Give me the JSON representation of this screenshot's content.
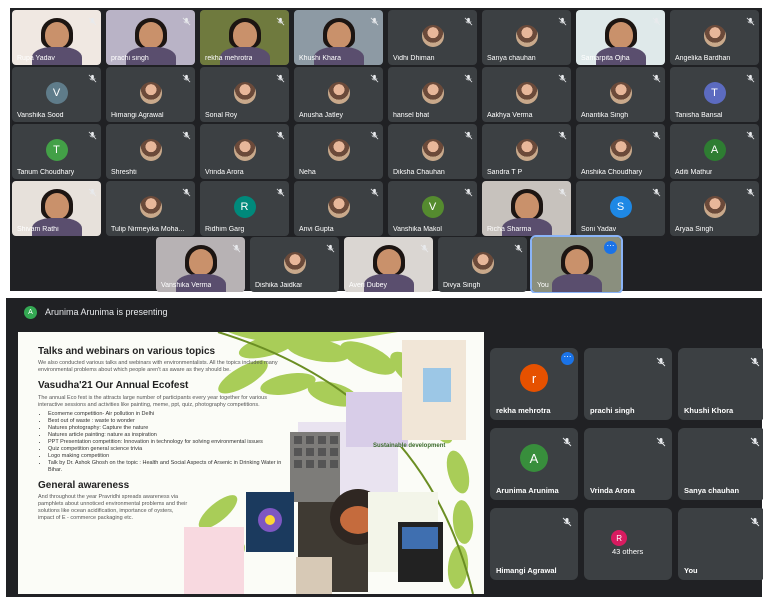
{
  "grid": {
    "row1": [
      {
        "name": "Rupa Yadav",
        "type": "camera",
        "bg": "#f0e8e2"
      },
      {
        "name": "prachi singh",
        "type": "camera",
        "bg": "#b9b3c6"
      },
      {
        "name": "rekha mehrotra",
        "type": "camera",
        "bg": "#6f7a3e"
      },
      {
        "name": "Khushi Khara",
        "type": "camera",
        "bg": "#8d9aa4"
      },
      {
        "name": "Vidhi Dhiman",
        "type": "photo"
      },
      {
        "name": "Sanya chauhan",
        "type": "photo"
      },
      {
        "name": "Samarpita Ojha",
        "type": "camera",
        "bg": "#dfe9ea"
      },
      {
        "name": "Angelika Bardhan",
        "type": "photo"
      }
    ],
    "row2": [
      {
        "name": "Vanshika Sood",
        "type": "letter",
        "letter": "V",
        "color": "#5f7c8a"
      },
      {
        "name": "Himangi Agrawal",
        "type": "photo"
      },
      {
        "name": "Sonal Roy",
        "type": "photo"
      },
      {
        "name": "Anusha Jatley",
        "type": "photo"
      },
      {
        "name": "hansel bhat",
        "type": "photo"
      },
      {
        "name": "Aakhya Verma",
        "type": "photo"
      },
      {
        "name": "Anantika Singh",
        "type": "photo"
      },
      {
        "name": "Tanisha Bansal",
        "type": "letter",
        "letter": "T",
        "color": "#5c6bc0"
      }
    ],
    "row3": [
      {
        "name": "Tanum Choudhary",
        "type": "letter",
        "letter": "T",
        "color": "#43a047"
      },
      {
        "name": "Shreshti",
        "type": "photo"
      },
      {
        "name": "Vrinda Arora",
        "type": "photo"
      },
      {
        "name": "Neha",
        "type": "photo"
      },
      {
        "name": "Diksha Chauhan",
        "type": "photo"
      },
      {
        "name": "Sandra T P",
        "type": "photo"
      },
      {
        "name": "Anshika Choudhary",
        "type": "photo"
      },
      {
        "name": "Aditi Mathur",
        "type": "letter",
        "letter": "A",
        "color": "#2e7d32"
      }
    ],
    "row4": [
      {
        "name": "Shivam Rathi",
        "type": "camera",
        "bg": "#e7e1db"
      },
      {
        "name": "Tulip Nirmeyika Moha...",
        "type": "photo"
      },
      {
        "name": "Ridhim Garg",
        "type": "letter",
        "letter": "R",
        "color": "#00897b"
      },
      {
        "name": "Anvi Gupta",
        "type": "photo"
      },
      {
        "name": "Vanshika Makol",
        "type": "letter",
        "letter": "V",
        "color": "#558b2f"
      },
      {
        "name": "Richa Sharma",
        "type": "camera",
        "bg": "#c7c2bd"
      },
      {
        "name": "Soni Yadav",
        "type": "letter",
        "letter": "S",
        "color": "#1e88e5"
      },
      {
        "name": "Aryaa Singh",
        "type": "photo"
      }
    ],
    "row5": [
      {
        "name": "Vanshika Verma",
        "type": "camera",
        "bg": "#b7b2b4"
      },
      {
        "name": "Dishika Jaidkar",
        "type": "photo"
      },
      {
        "name": "Averi Dubey",
        "type": "camera",
        "bg": "#dad6d2"
      },
      {
        "name": "Divya Singh",
        "type": "photo"
      },
      {
        "name": "You",
        "type": "camera",
        "bg": "#8a8f7e"
      }
    ]
  },
  "presenting": {
    "avatar_letter": "A",
    "text": "Arunima Arunima is presenting"
  },
  "slide": {
    "heading1": "Talks and webinars on various topics",
    "para1": "We also conducted various talks and webinars with environmentalists. All the topics included many environmental problems about which people aren't as aware as they should be.",
    "heading2": "Vasudha'21 Our Annual Ecofest",
    "para2": "The annual Eco fest is the attracts large number of participants every year together for various interactive sessions and activities like painting, meme, ppt, quiz, photography competitions.",
    "bullets": [
      "Ecomeme competition- Air pollution in Delhi",
      "Best out of waste : waste to wonder",
      "Natures photography: Capture the nature",
      "Natures article painting: nature as inspiration",
      "PPT Presentation competition: Innovation in technology for solving environmental issues",
      "Quiz competition general science trivia",
      "Logo making competition",
      "Talk by Dr. Ashok Ghosh on the topic : Health and Social Aspects of Arsenic in Drinking Water in Bihar."
    ],
    "heading3": "General awareness",
    "para3": "And throughout the year Pravridhi spreads awareness via pamphlets about unnoticed environmental problems and their solutions like ocean acidification, importance of oysters, impact of E - commerce packaging etc.",
    "poster_title": "Sustainable development"
  },
  "side_tiles": [
    {
      "name": "rekha mehrotra",
      "type": "letter",
      "letter": "r",
      "color": "#e65100",
      "more": true
    },
    {
      "name": "prachi singh",
      "type": "camera",
      "bg": "#b9b3c6"
    },
    {
      "name": "Khushi Khora",
      "type": "camera",
      "bg": "#8d9aa4"
    },
    {
      "name": "Arunima Arunima",
      "type": "letter",
      "letter": "A",
      "color": "#388e3c"
    },
    {
      "name": "Vrinda Arora",
      "type": "photo"
    },
    {
      "name": "Sanya chauhan",
      "type": "photo"
    },
    {
      "name": "Himangi Agrawal",
      "type": "photo"
    },
    {
      "name": "43 others",
      "type": "others",
      "letter": "R"
    },
    {
      "name": "You",
      "type": "photo"
    }
  ],
  "icons": {
    "mic_off": "mic-off-icon",
    "more": "more-options-icon"
  }
}
